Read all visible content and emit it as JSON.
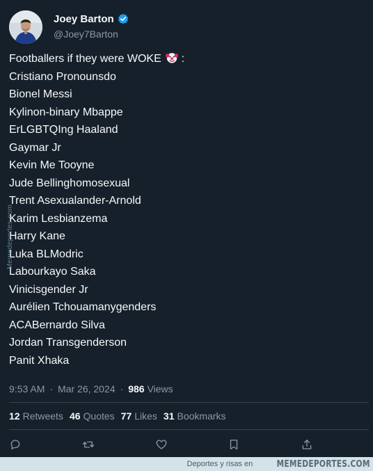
{
  "author": {
    "display_name": "Joey Barton",
    "handle": "@Joey7Barton",
    "verified_icon": "verified-badge-icon"
  },
  "tweet": {
    "intro": "Footballers if they were WOKE",
    "intro_suffix": ":",
    "intro_emoji": "clown-face-icon",
    "lines": [
      "Cristiano Pronounsdo",
      "Bionel Messi",
      "Kylinon-binary Mbappe",
      "ErLGBTQIng Haaland",
      "Gaymar Jr",
      "Kevin Me Tooyne",
      "Jude Bellinghomosexual",
      "Trent Asexualander-Arnold",
      "Karim Lesbianzema",
      "Harry Kane",
      "Luka BLModric",
      "Labourkayo Saka",
      "Vinicisgender Jr",
      "Aurélien Tchouamanygenders",
      "ACABernardo Silva",
      "Jordan Transgenderson",
      "Panit Xhaka"
    ]
  },
  "meta": {
    "time": "9:53 AM",
    "separator": "·",
    "date": "Mar 26, 2024",
    "views_count": "986",
    "views_label": "Views"
  },
  "stats": [
    {
      "count": "12",
      "label": "Retweets"
    },
    {
      "count": "46",
      "label": "Quotes"
    },
    {
      "count": "77",
      "label": "Likes"
    },
    {
      "count": "31",
      "label": "Bookmarks"
    }
  ],
  "actions": [
    "reply-icon",
    "retweet-icon",
    "like-icon",
    "bookmark-icon",
    "share-icon"
  ],
  "watermark": {
    "side": "Memedeportes.com",
    "footer_tag": "Deportes y risas en",
    "footer_brand": "MEMEDEPORTES.COM"
  },
  "colors": {
    "background": "#15202b",
    "text": "#f7f9f9",
    "muted": "#8b98a5",
    "divider": "#38444d",
    "verified": "#1d9bf0",
    "footer_bg": "#d4e3ea"
  }
}
